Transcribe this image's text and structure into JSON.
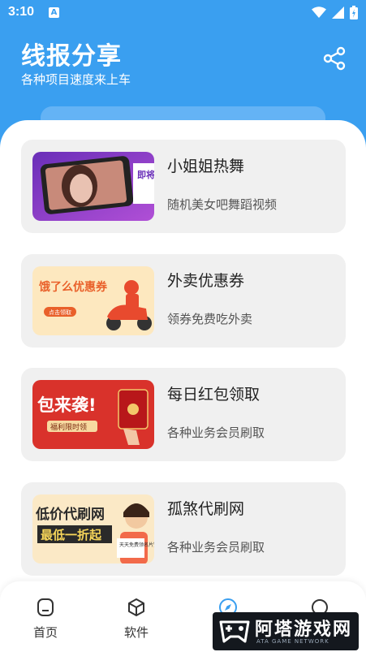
{
  "status_bar": {
    "time": "3:10",
    "notification_badge": "A",
    "icons": [
      "wifi-icon",
      "signal-icon",
      "battery-icon"
    ]
  },
  "header": {
    "title": "线报分享",
    "subtitle": "各种项目速度来上车",
    "action_icon": "share-icon"
  },
  "cards": [
    {
      "title": "小姐姐热舞",
      "description": "随机美女吧舞蹈视频",
      "thumb_text": "即将播放"
    },
    {
      "title": "外卖优惠券",
      "description": "领券免费吃外卖",
      "thumb_text": "饿了么优惠券",
      "thumb_button": "点击领取"
    },
    {
      "title": "每日红包领取",
      "description": "各种业务会员刷取",
      "thumb_text": "包来袭!",
      "thumb_button": "福利限时领"
    },
    {
      "title": "孤煞代刷网",
      "description": "各种业务会员刷取",
      "thumb_text_1": "低价代刷网",
      "thumb_text_2": "最低一折起",
      "thumb_badge": "天天免费领名片赞"
    }
  ],
  "bottom_nav": [
    {
      "label": "首页",
      "icon": "home-icon"
    },
    {
      "label": "软件",
      "icon": "box-icon"
    },
    {
      "label": "",
      "icon": "compass-icon"
    },
    {
      "label": "",
      "icon": "profile-icon"
    }
  ],
  "watermark": {
    "title": "阿塔游戏网",
    "subtitle": "ATA GAME NETWORK"
  },
  "colors": {
    "primary": "#3a9ff0",
    "card_bg": "#f0f0f0",
    "accent": "#3a9ff0"
  }
}
